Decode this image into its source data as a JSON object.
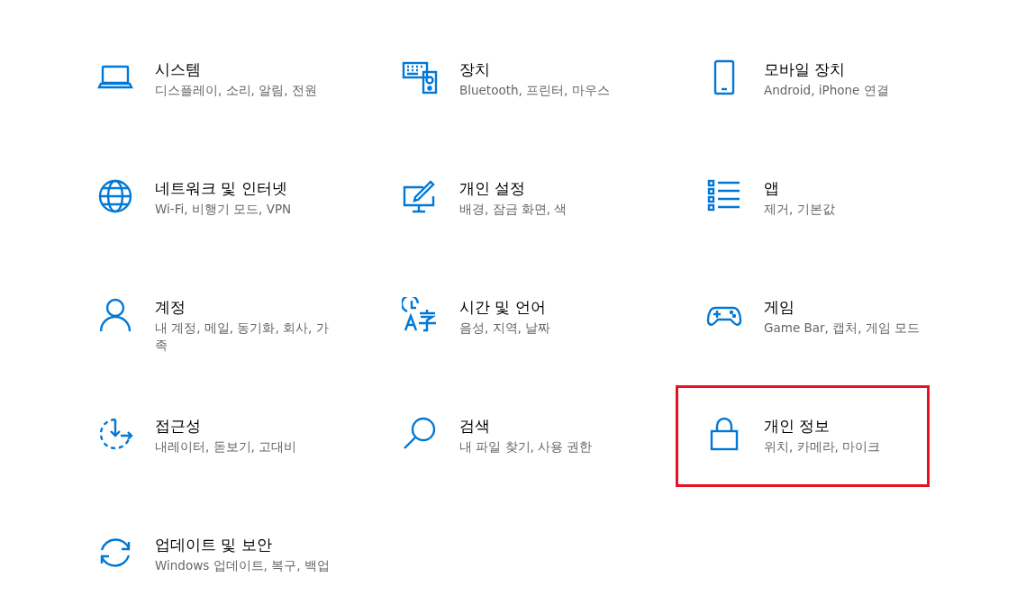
{
  "categories": [
    {
      "title": "시스템",
      "subtitle": "디스플레이, 소리, 알림, 전원",
      "highlighted": false
    },
    {
      "title": "장치",
      "subtitle": "Bluetooth, 프린터, 마우스",
      "highlighted": false
    },
    {
      "title": "모바일 장치",
      "subtitle": "Android, iPhone 연결",
      "highlighted": false
    },
    {
      "title": "네트워크 및 인터넷",
      "subtitle": "Wi-Fi, 비행기 모드, VPN",
      "highlighted": false
    },
    {
      "title": "개인 설정",
      "subtitle": "배경, 잠금 화면, 색",
      "highlighted": false
    },
    {
      "title": "앱",
      "subtitle": "제거, 기본값",
      "highlighted": false
    },
    {
      "title": "계정",
      "subtitle": "내 계정, 메일, 동기화, 회사, 가족",
      "highlighted": false
    },
    {
      "title": "시간 및 언어",
      "subtitle": "음성, 지역, 날짜",
      "highlighted": false
    },
    {
      "title": "게임",
      "subtitle": "Game Bar, 캡처, 게임 모드",
      "highlighted": false
    },
    {
      "title": "접근성",
      "subtitle": "내레이터, 돋보기, 고대비",
      "highlighted": false
    },
    {
      "title": "검색",
      "subtitle": "내 파일 찾기, 사용 권한",
      "highlighted": false
    },
    {
      "title": "개인 정보",
      "subtitle": "위치, 카메라, 마이크",
      "highlighted": true
    },
    {
      "title": "업데이트 및 보안",
      "subtitle": "Windows 업데이트, 복구, 백업",
      "highlighted": false
    }
  ]
}
